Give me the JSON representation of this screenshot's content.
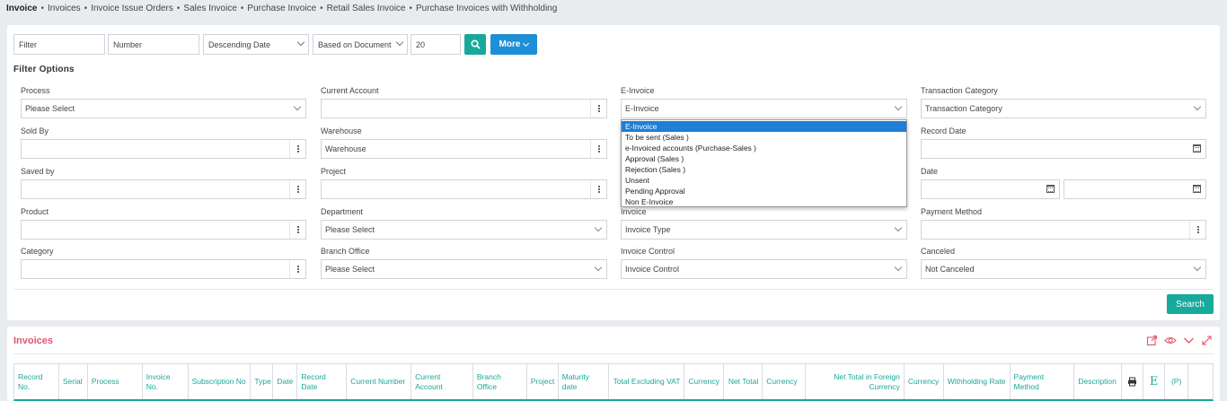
{
  "breadcrumb": {
    "first": "Invoice",
    "items": [
      "Invoices",
      "Invoice Issue Orders",
      "Sales Invoice",
      "Purchase Invoice",
      "Retail Sales Invoice",
      "Purchase Invoices with Withholding"
    ]
  },
  "toolbar": {
    "filter_placeholder": "Filter",
    "number_placeholder": "Number",
    "sort_value": "Descending Date",
    "based_on_value": "Based on Document",
    "page_size": "20",
    "more_label": "More"
  },
  "filter_options_title": "Filter Options",
  "fields": {
    "process": {
      "label": "Process",
      "value": "Please Select"
    },
    "current_account": {
      "label": "Current Account",
      "value": ""
    },
    "e_invoice": {
      "label": "E-Invoice",
      "value": "E-Invoice"
    },
    "transaction_category": {
      "label": "Transaction Category",
      "value": "Transaction Category"
    },
    "sold_by": {
      "label": "Sold By",
      "value": ""
    },
    "warehouse": {
      "label": "Warehouse",
      "value": "Warehouse"
    },
    "record_date": {
      "label": "Record Date",
      "value": ""
    },
    "saved_by": {
      "label": "Saved by",
      "value": ""
    },
    "project": {
      "label": "Project",
      "value": ""
    },
    "date": {
      "label": "Date",
      "value": ""
    },
    "product": {
      "label": "Product",
      "value": ""
    },
    "department": {
      "label": "Department",
      "value": "Please Select"
    },
    "invoice": {
      "label": "Invoice",
      "value": "Invoice Type"
    },
    "payment_method": {
      "label": "Payment Method",
      "value": ""
    },
    "category": {
      "label": "Category",
      "value": ""
    },
    "branch_office": {
      "label": "Branch Office",
      "value": "Please Select"
    },
    "invoice_control": {
      "label": "Invoice Control",
      "value": "Invoice Control"
    },
    "canceled": {
      "label": "Canceled",
      "value": "Not Canceled"
    }
  },
  "e_invoice_options": [
    "E-Invoice",
    "To be sent (Sales )",
    "e-Invoiced accounts (Purchase-Sales )",
    "Approval (Sales )",
    "Rejection (Sales )",
    "Unsent",
    "Pending Approval",
    "Non E-Invoice"
  ],
  "search_label": "Search",
  "list": {
    "title": "Invoices",
    "columns": [
      "Record No.",
      "Serial",
      "Process",
      "Invoice No.",
      "Subscription No",
      "Type",
      "Date",
      "Record Date",
      "Current Number",
      "Current Account",
      "Branch Office",
      "Project",
      "Maturity date",
      "Total Excluding VAT",
      "Currency",
      "Net Total",
      "Currency",
      "Net Total in Foreign Currency",
      "Currency",
      "Withholding Rate",
      "Payment Method",
      "Description",
      "",
      "E",
      "(P)",
      ""
    ]
  },
  "colors": {
    "teal": "#17a99b",
    "blue": "#1e8fd6",
    "title_red": "#e0566b",
    "selection": "#1e7fd6"
  }
}
